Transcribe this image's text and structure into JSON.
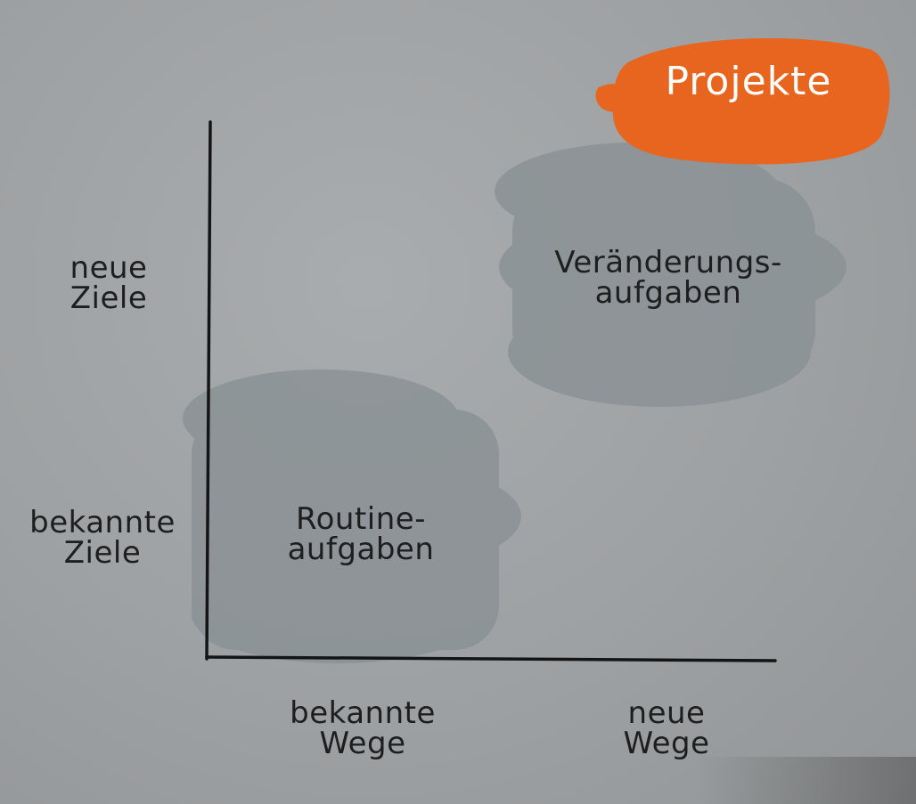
{
  "title": {
    "text": "Projekte",
    "color": "#e8651f"
  },
  "axes": {
    "y_top": [
      "neue",
      "Ziele"
    ],
    "y_bottom": [
      "bekannte",
      "Ziele"
    ],
    "x_left": [
      "bekannte",
      "Wege"
    ],
    "x_right": [
      "neue",
      "Wege"
    ]
  },
  "quadrants": {
    "routine": [
      "Routine-",
      "aufgaben"
    ],
    "change": [
      "Veränderungs-",
      "aufgaben"
    ]
  },
  "colors": {
    "background": "#9e a1a3",
    "blob": "#8a9194",
    "axis": "#141414",
    "badge": "#e8651f"
  }
}
